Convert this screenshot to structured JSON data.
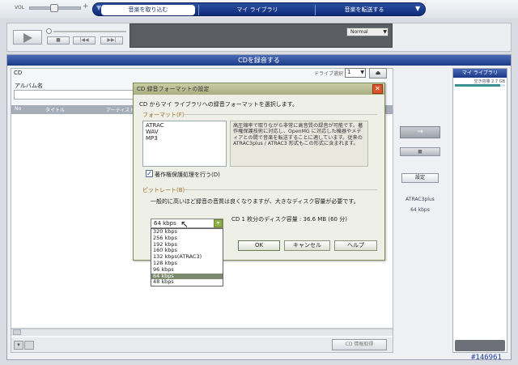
{
  "topbar": {
    "vol_label": "VOL",
    "vol_plus": "+",
    "tabs": {
      "import": "音楽を取り込む",
      "library": "マイ ライブラリ",
      "transfer": "音楽を転送する"
    },
    "right_arrow": "▼",
    "left_arrow": "▼"
  },
  "player": {
    "playmode": "Normal",
    "playmode_arrow": "▼"
  },
  "main": {
    "title": "CDを録音する",
    "cd_label": "CD",
    "drive_label": "ドライブ選択",
    "drive_value": "1",
    "drive_arrow": "▼",
    "eject": "⏏",
    "album_label": "アルバム名",
    "columns": {
      "no": "No",
      "title": "タイトル",
      "artist": "アーティスト"
    },
    "cd_info_button": "CD 情報取得",
    "bottom_btn": "▾"
  },
  "mid": {
    "transfer_arrow": "→",
    "stop_label": "■",
    "settings": "設定",
    "format": "ATRAC3plus",
    "bitrate": "64 kbps"
  },
  "library": {
    "title": "マイ ライブラリ",
    "capacity": "空き容量 2.7 GB",
    "capacity_used_fraction": 0.9
  },
  "dialog": {
    "title": "CD 録音フォーマットの設定",
    "close": "✕",
    "description": "CD からマイ ライブラリへの録音フォーマットを選択します。",
    "format_label": "フォーマット(F)",
    "formats": [
      "ATRAC",
      "WAV",
      "MP3"
    ],
    "format_description": "高圧縮率で取りながら非常に高音質の録音が可能です。著作権保護技術に対応し、OpenMG に対応した機器やメディアとの間で音楽を転送することに適しています。従来の ATRAC3plus / ATRAC3 形式もこの形式に含まれます。",
    "copy_protect_check": "✓",
    "copy_protect_label": "著作権保護処理を行う(D)",
    "bitrate_label": "ビットレート(B)",
    "bitrate_description": "一般的に高いほど録音の音質は良くなりますが、大きなディスク容量が必要です。",
    "disk_capacity": "CD 1 枚分のディスク容量 : 36.6 MB (60 分)",
    "bitrate_selected": "64 kbps",
    "bitrate_arrow": "▾",
    "bitrate_options": [
      "320 kbps",
      "256 kbps",
      "192 kbps",
      "160 kbps",
      "132 kbps(ATRAC3)",
      "128 kbps",
      "96 kbps",
      "64 kbps",
      "48 kbps"
    ],
    "ok": "OK",
    "cancel": "キャンセル",
    "help": "ヘルプ"
  },
  "watermark": "#146961",
  "colors": {
    "accent_blue": "#1b3a86",
    "dialog_title": "#a8ae80",
    "close_red": "#d9542a",
    "selected_option": "#7d8a6d"
  },
  "icons": {
    "cursor": "mouse-pointer-icon",
    "play": "play-icon",
    "eject": "eject-icon"
  }
}
